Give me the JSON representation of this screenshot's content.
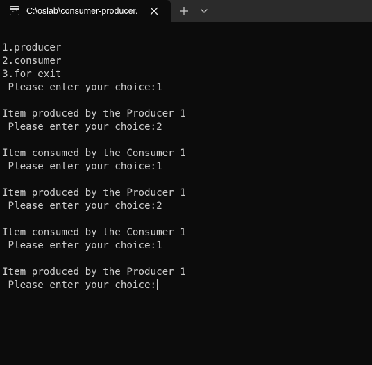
{
  "tab": {
    "title": "C:\\oslab\\consumer-producer.",
    "icon": "terminal-icon",
    "icon_text": "C:\\"
  },
  "toolbar": {
    "new_tab_icon": "plus-icon",
    "dropdown_icon": "chevron-down-icon",
    "close_icon": "close-icon"
  },
  "console": {
    "lines": [
      "",
      "1.producer",
      "2.consumer",
      "3.for exit",
      " Please enter your choice:1",
      "",
      "Item produced by the Producer 1",
      " Please enter your choice:2",
      "",
      "Item consumed by the Consumer 1",
      " Please enter your choice:1",
      "",
      "Item produced by the Producer 1",
      " Please enter your choice:2",
      "",
      "Item consumed by the Consumer 1",
      " Please enter your choice:1",
      "",
      "Item produced by the Producer 1"
    ],
    "prompt": " Please enter your choice:"
  },
  "colors": {
    "background": "#0c0c0c",
    "tabbar": "#2b2b2b",
    "text": "#cccccc"
  }
}
